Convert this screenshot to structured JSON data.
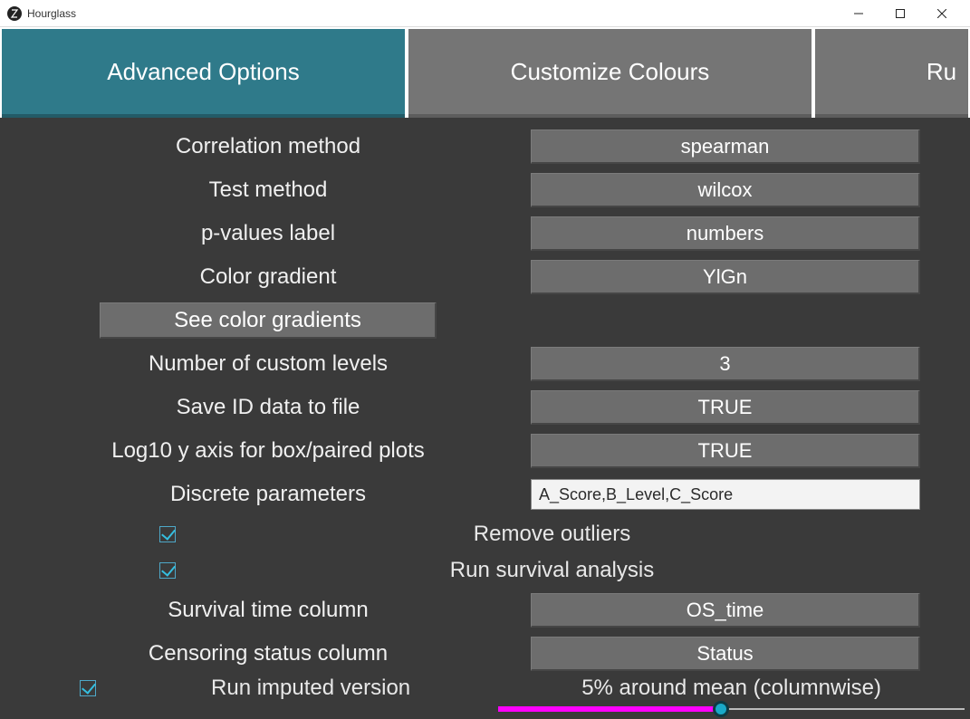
{
  "window": {
    "title": "Hourglass"
  },
  "tabs": {
    "advanced": "Advanced Options",
    "colours": "Customize Colours",
    "run_partial": "Ru"
  },
  "rows": {
    "correlation": {
      "label": "Correlation method",
      "value": "spearman"
    },
    "testmethod": {
      "label": "Test method",
      "value": "wilcox"
    },
    "pvalues": {
      "label": "p-values label",
      "value": "numbers"
    },
    "colorgrad": {
      "label": "Color gradient",
      "value": "YlGn"
    },
    "seegradients": {
      "label": "See color gradients"
    },
    "numlevels": {
      "label": "Number of custom levels",
      "value": "3"
    },
    "saveid": {
      "label": "Save ID data to file",
      "value": "TRUE"
    },
    "log10": {
      "label": "Log10 y axis for box/paired plots",
      "value": "TRUE"
    },
    "discrete": {
      "label": "Discrete parameters",
      "value": "A_Score,B_Level,C_Score"
    },
    "removeoutliers": {
      "label": "Remove outliers"
    },
    "runsurvival": {
      "label": "Run survival analysis"
    },
    "survtime": {
      "label": "Survival time column",
      "value": "OS_time"
    },
    "censoring": {
      "label": "Censoring status column",
      "value": "Status"
    },
    "imputed": {
      "label": "Run imputed version"
    },
    "slider": {
      "caption": "5% around mean (columnwise)"
    }
  }
}
